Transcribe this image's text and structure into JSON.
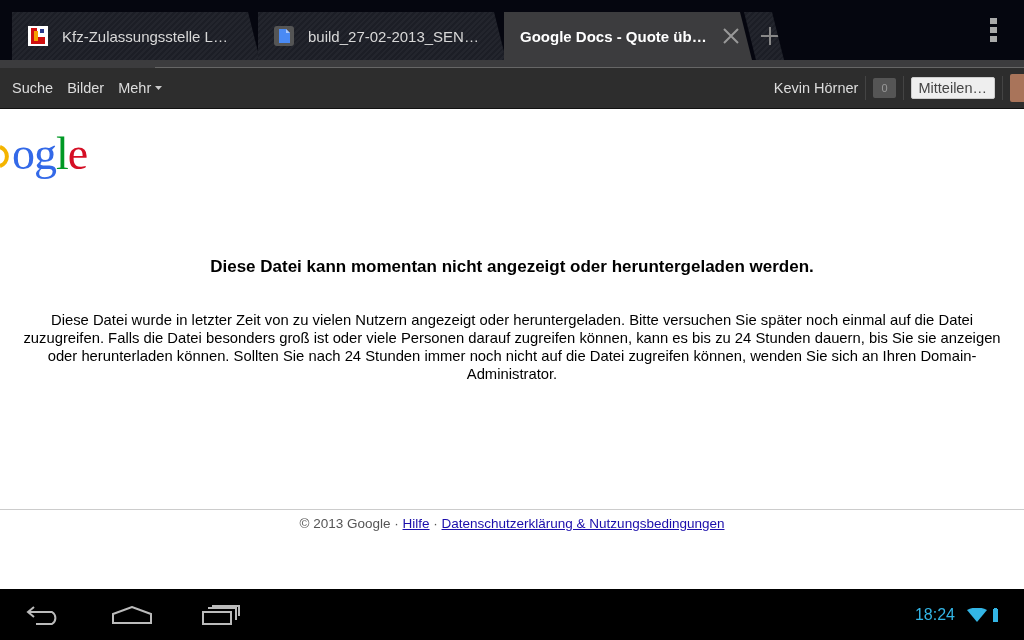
{
  "tabs": [
    {
      "label": "Kfz-Zulassungsstelle L…",
      "selected": false,
      "kind": "site"
    },
    {
      "label": "build_27-02-2013_SEN…",
      "selected": false,
      "kind": "doc"
    },
    {
      "label": "Google Docs - Quote üb…",
      "selected": true,
      "kind": "plain"
    }
  ],
  "google_bar": {
    "links": [
      {
        "label": "Suche",
        "dropdown": false
      },
      {
        "label": "Bilder",
        "dropdown": false
      },
      {
        "label": "Mehr",
        "dropdown": true
      }
    ],
    "user_name": "Kevin Hörner",
    "notification_count": "0",
    "share_button": "Mitteilen…"
  },
  "logo": "ogle",
  "heading": "Diese Datei kann momentan nicht angezeigt oder heruntergeladen werden.",
  "message": "Diese Datei wurde in letzter Zeit von zu vielen Nutzern angezeigt oder heruntergeladen. Bitte versuchen Sie später noch einmal auf die Datei zuzugreifen. Falls die Datei besonders groß ist oder viele Personen darauf zugreifen können, kann es bis zu 24 Stunden dauern, bis Sie sie anzeigen oder herunterladen können. Sollten Sie nach 24 Stunden immer noch nicht auf die Datei zugreifen können, wenden Sie sich an Ihren Domain-Administrator.",
  "footer": {
    "copyright": "© 2013 Google ·",
    "links": [
      "Hilfe",
      "Datenschutzerklärung & Nutzungsbedingungen"
    ],
    "separator": "·"
  },
  "system_bar": {
    "time": "18:24"
  }
}
